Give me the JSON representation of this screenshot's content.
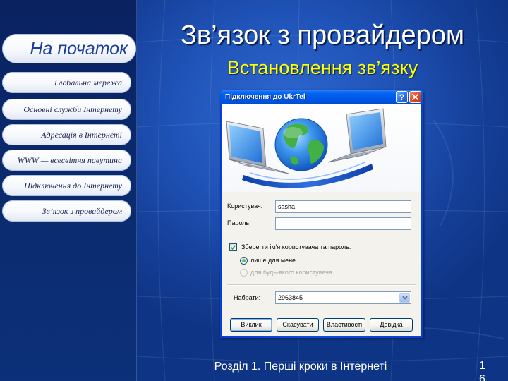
{
  "slide": {
    "title": "Зв’язок з провайдером",
    "subtitle": "Встановлення зв’язку",
    "footer": "Розділ 1. Перші кроки в Інтернеті",
    "page_number": "16"
  },
  "sidebar": {
    "home_label": "На початок",
    "items": [
      {
        "label": "Глобальна мережа"
      },
      {
        "label": "Основні служби Інтернету"
      },
      {
        "label": "Адресація в Інтернеті"
      },
      {
        "label": "WWW — всесвітня павутина"
      },
      {
        "label": "Підключення до Інтернету"
      },
      {
        "label": "Зв’язок з провайдером"
      }
    ]
  },
  "dialog": {
    "title": "Підключення до UkrTel",
    "help_label": "?",
    "user_label": "Користувач:",
    "user_value": "sasha",
    "password_label": "Пароль:",
    "password_value": "",
    "save_label": "Зберегти ім'я користувача та пароль:",
    "save_checked": true,
    "only_me_label": "лише для мене",
    "only_me_selected": true,
    "anyone_label": "для будь-якого користувача",
    "anyone_selected": false,
    "anyone_enabled": false,
    "dial_label": "Набрати:",
    "dial_value": "2963845",
    "buttons": {
      "dial": "Виклик",
      "cancel": "Скасувати",
      "properties": "Властивості",
      "help": "Довідка"
    }
  },
  "icons": {
    "help": "help-icon",
    "close": "close-icon",
    "dropdown": "chevron-down-icon",
    "checkmark": "checkmark-icon",
    "illustration": "globe-network-icon"
  },
  "colors": {
    "title": "#ffffff",
    "subtitle": "#ffff00",
    "home_text": "#1c3c9e",
    "nav_text": "#1b2450",
    "titlebar": "#0058e8",
    "close_button": "#e04a26"
  }
}
